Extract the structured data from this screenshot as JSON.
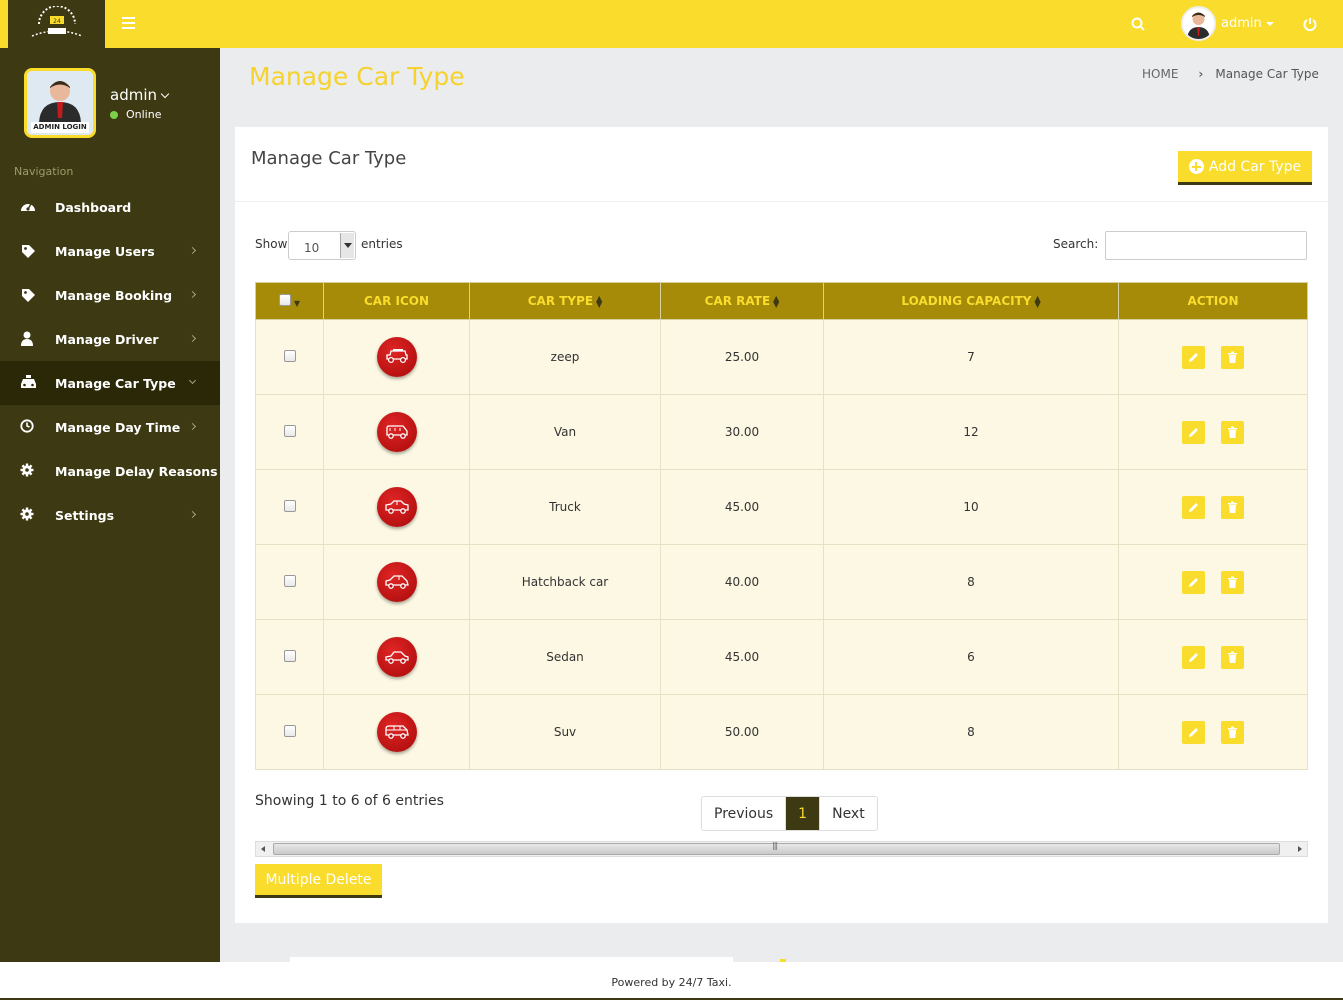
{
  "header": {
    "username": "admin",
    "logo_icon": "taxi-logo-icon",
    "menu_icon": "hamburger-icon",
    "search_icon": "search-icon",
    "power_icon": "power-icon"
  },
  "sidebar": {
    "user_name": "admin",
    "status": "Online",
    "avatar_caption": "ADMIN LOGIN",
    "nav_title": "Navigation",
    "items": [
      {
        "label": "Dashboard",
        "icon": "dashboard-icon"
      },
      {
        "label": "Manage Users",
        "icon": "tag-icon"
      },
      {
        "label": "Manage Booking",
        "icon": "tag-icon"
      },
      {
        "label": "Manage Driver",
        "icon": "user-icon"
      },
      {
        "label": "Manage Car Type",
        "icon": "taxi-icon"
      },
      {
        "label": "Manage Day Time",
        "icon": "clock-icon"
      },
      {
        "label": "Manage Delay Reasons",
        "icon": "gear-icon"
      },
      {
        "label": "Settings",
        "icon": "gear-icon"
      }
    ]
  },
  "page": {
    "title": "Manage Car Type",
    "breadcrumb": {
      "home": "HOME",
      "separator": "›",
      "current": "Manage Car Type"
    }
  },
  "panel": {
    "title": "Manage Car Type",
    "add_button": "Add Car Type",
    "show_label": "Show",
    "length_value": "10",
    "entries_label": "entries",
    "search_label": "Search:",
    "search_value": ""
  },
  "table": {
    "columns": [
      "CAR ICON",
      "CAR TYPE",
      "CAR RATE",
      "LOADING CAPACITY",
      "ACTION"
    ],
    "rows": [
      {
        "type": "zeep",
        "rate": "25.00",
        "capacity": "7",
        "icon": "jeep-icon"
      },
      {
        "type": "Van",
        "rate": "30.00",
        "capacity": "12",
        "icon": "van-icon"
      },
      {
        "type": "Truck",
        "rate": "45.00",
        "capacity": "10",
        "icon": "truck-icon"
      },
      {
        "type": "Hatchback car",
        "rate": "40.00",
        "capacity": "8",
        "icon": "hatchback-icon"
      },
      {
        "type": "Sedan",
        "rate": "45.00",
        "capacity": "6",
        "icon": "sedan-icon"
      },
      {
        "type": "Suv",
        "rate": "50.00",
        "capacity": "8",
        "icon": "suv-icon"
      }
    ],
    "info": "Showing 1 to 6 of 6 entries",
    "pagination": {
      "previous": "Previous",
      "current": "1",
      "next": "Next"
    },
    "multi_delete": "Multiple Delete"
  },
  "footer": {
    "text": "Powered by 24/7 Taxi."
  },
  "colors": {
    "brand_yellow": "#f9dc2c",
    "sidebar_dark": "#3c3913",
    "table_header": "#a58b07",
    "row_bg": "#fcf8e3",
    "car_icon_red": "#c41212"
  }
}
